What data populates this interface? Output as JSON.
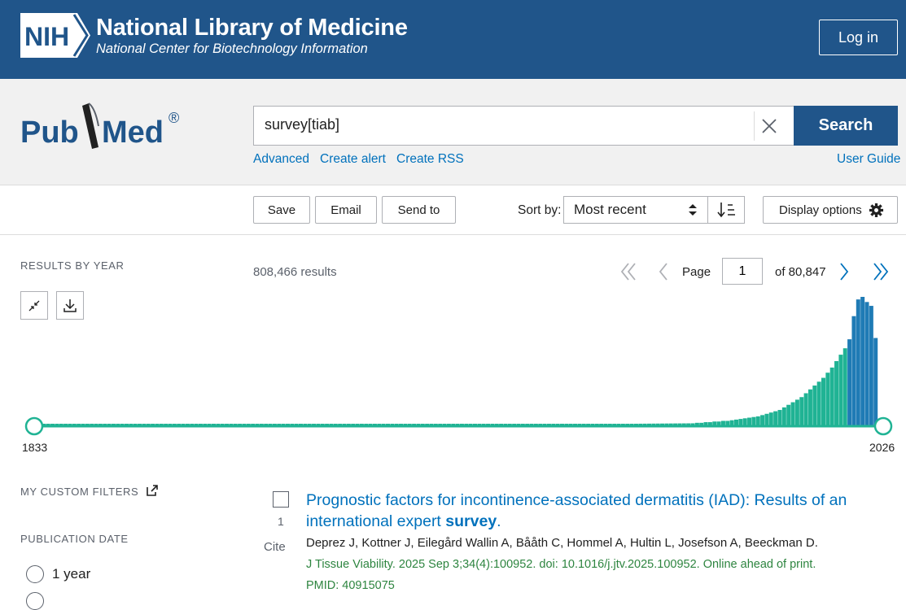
{
  "header": {
    "logo_text": "NIH",
    "title": "National Library of Medicine",
    "subtitle": "National Center for Biotechnology Information",
    "login_label": "Log in"
  },
  "brand": {
    "pubmed_logo_text": "PubMed",
    "registered": "®"
  },
  "search": {
    "query": "survey[tiab]",
    "button_label": "Search",
    "links": [
      "Advanced",
      "Create alert",
      "Create RSS"
    ],
    "user_guide": "User Guide"
  },
  "toolbar": {
    "save": "Save",
    "email": "Email",
    "send_to": "Send to",
    "sort_label": "Sort by:",
    "sort_value": "Most recent",
    "display_options": "Display options"
  },
  "results_by_year": {
    "label": "RESULTS BY YEAR",
    "start_year": "1833",
    "end_year": "2026"
  },
  "results": {
    "count": "808,466 results",
    "page_label": "Page",
    "page_value": "1",
    "page_total": "of 80,847"
  },
  "filters": {
    "custom_filters_label": "MY CUSTOM FILTERS",
    "publication_date_label": "PUBLICATION DATE",
    "option_1": "1 year"
  },
  "result_items": [
    {
      "number": "1",
      "cite": "Cite",
      "title_prefix": "Prognostic factors for incontinence-associated dermatitis (IAD): Results of an international expert ",
      "title_highlight": "survey",
      "title_suffix": ".",
      "authors": "Deprez J, Kottner J, Eilegård Wallin A, Bååth C, Hommel A, Hultin L, Josefson A, Beeckman D.",
      "journal": "J Tissue Viability. 2025 Sep 3;34(4):100952. doi: 10.1016/j.jtv.2025.100952. Online ahead of print.",
      "pmid": "PMID: 40915075"
    }
  ],
  "colors": {
    "header_blue": "#20558a",
    "link_blue": "#0071bc",
    "bar_green": "#20b394",
    "bar_blue": "#1f7bb5",
    "journal_green": "#2e8540"
  },
  "chart_data": {
    "type": "bar",
    "title": "",
    "xlabel": "",
    "ylabel": "",
    "xlim": [
      1833,
      2026
    ],
    "recent_years_highlight": "blue bars for latest years",
    "tail_values_relative": [
      0.02,
      0.02,
      0.025,
      0.025,
      0.03,
      0.03,
      0.035,
      0.035,
      0.04,
      0.045,
      0.05,
      0.055,
      0.06,
      0.065,
      0.07,
      0.08,
      0.09,
      0.1,
      0.11,
      0.12,
      0.14,
      0.16,
      0.18,
      0.2,
      0.22,
      0.25,
      0.28,
      0.31,
      0.34,
      0.37,
      0.41,
      0.45,
      0.5,
      0.55,
      0.6,
      0.67,
      0.85,
      0.98,
      1.0,
      0.96,
      0.93,
      0.68
    ]
  }
}
